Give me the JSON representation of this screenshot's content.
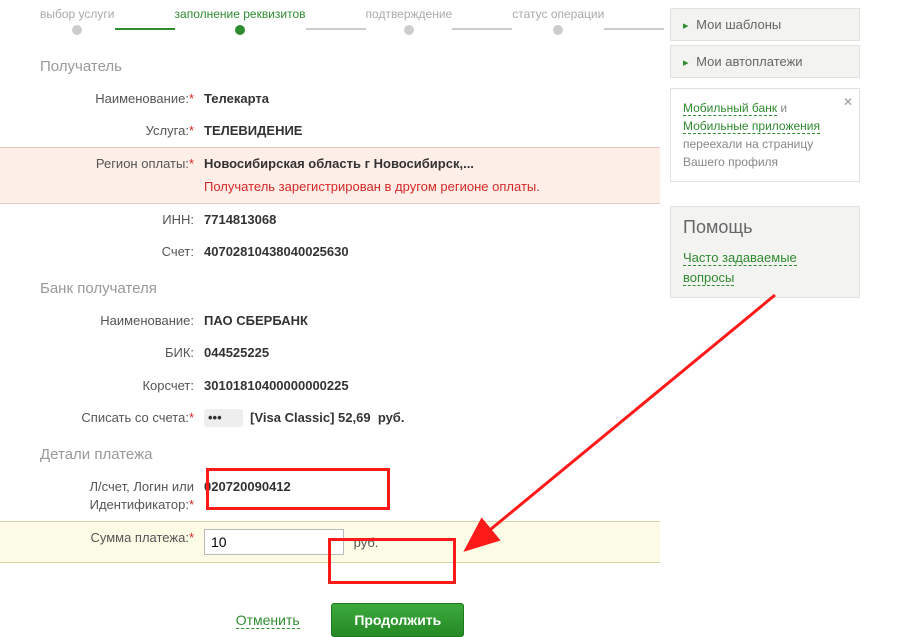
{
  "stepper": {
    "steps": [
      {
        "label": "выбор услуги",
        "active": false
      },
      {
        "label": "заполнение реквизитов",
        "active": true
      },
      {
        "label": "подтверждение",
        "active": false
      },
      {
        "label": "статус операции",
        "active": false
      }
    ]
  },
  "sections": {
    "recipient_title": "Получатель",
    "bank_title": "Банк получателя",
    "details_title": "Детали платежа"
  },
  "labels": {
    "name": "Наименование:",
    "service": "Услуга:",
    "region": "Регион оплаты:",
    "inn": "ИНН:",
    "account": "Счет:",
    "bank_name": "Наименование:",
    "bik": "БИК:",
    "korr": "Корсчет:",
    "from_account": "Списать со счета:",
    "ident": "Л/счет, Логин или Идентификатор:",
    "amount": "Сумма платежа:",
    "rub": "руб."
  },
  "values": {
    "name": "Телекарта",
    "service": "ТЕЛЕВИДЕНИЕ",
    "region": "Новосибирская область г Новосибирск,...",
    "region_warning": "Получатель зарегистрирован в другом регионе оплаты.",
    "inn": "7714813068",
    "account": "40702810438040025630",
    "bank_name": "ПАО СБЕРБАНК",
    "bik": "044525225",
    "korr": "30101810400000000225",
    "from_account_card": "[Visa Classic] 52,69",
    "from_account_currency": "руб.",
    "ident": "020720090412",
    "amount": "10"
  },
  "actions": {
    "cancel": "Отменить",
    "continue": "Продолжить"
  },
  "sidebar": {
    "templates": "Мои шаблоны",
    "autopay": "Мои автоплатежи",
    "notice_link1": "Мобильный банк",
    "notice_and": " и ",
    "notice_link2": "Мобильные приложения",
    "notice_rest": " переехали на страницу Вашего профиля",
    "help_title": "Помощь",
    "faq": "Часто задаваемые вопросы"
  }
}
